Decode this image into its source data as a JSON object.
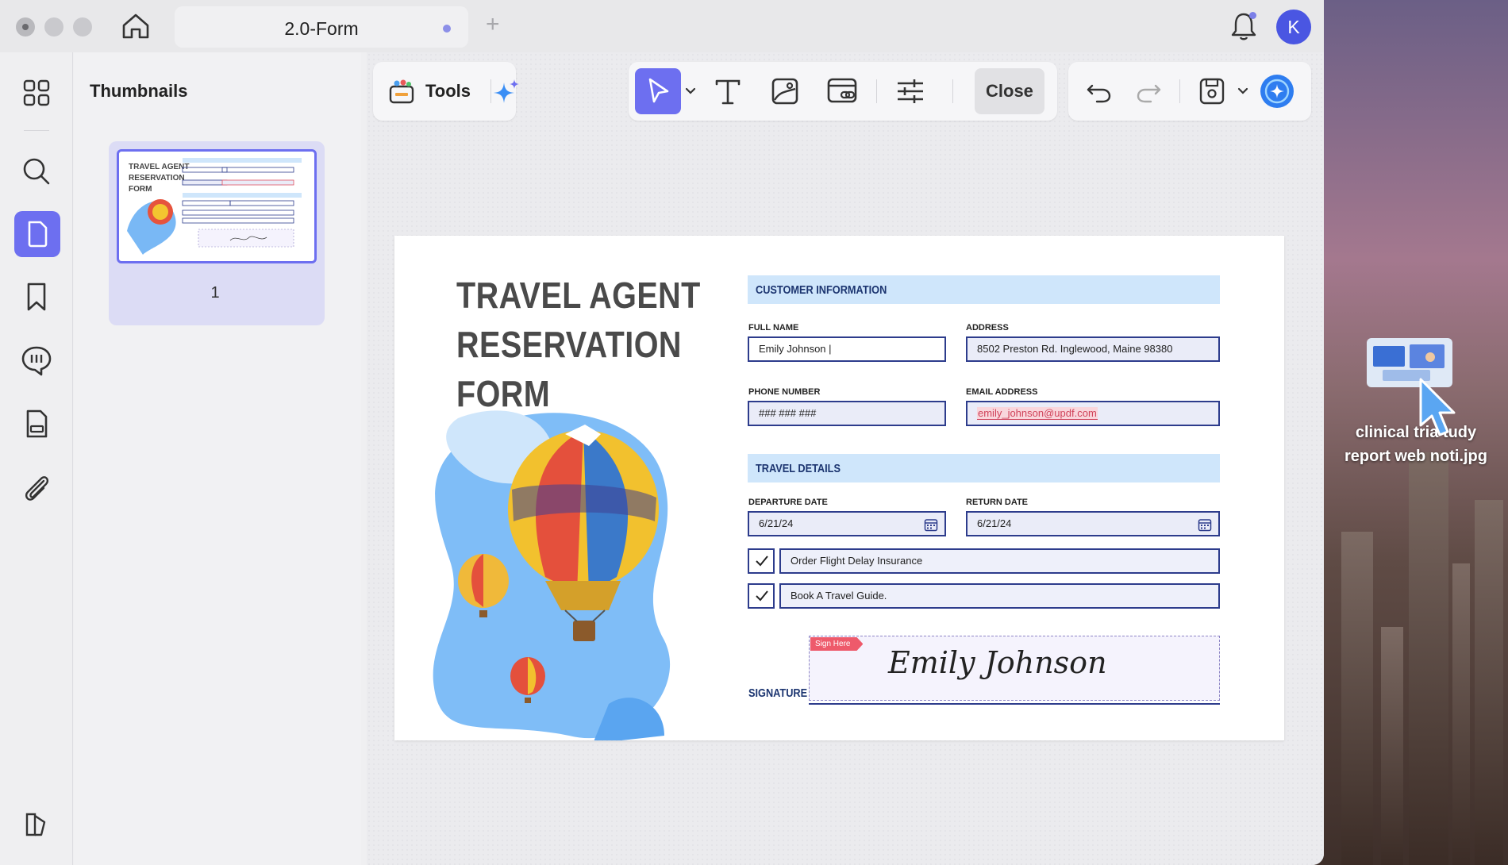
{
  "window": {
    "tab_title": "2.0-Form",
    "tab_add": "+",
    "avatar_letter": "K",
    "accent": "#6d6ff0"
  },
  "sidebar": {
    "icons": [
      "grid-icon",
      "search-icon",
      "page-icon",
      "bookmark-icon",
      "comment-icon",
      "form-icon",
      "attachment-icon",
      "layers-icon"
    ],
    "active": "page-icon"
  },
  "thumbnails": {
    "title": "Thumbnails",
    "page_number": "1"
  },
  "toolbar": {
    "tools_label": "Tools",
    "close_label": "Close"
  },
  "form": {
    "title_lines": [
      "TRAVEL AGENT",
      "RESERVATION",
      "FORM"
    ],
    "customer_info": "CUSTOMER INFORMATION",
    "full_name_label": "FULL NAME",
    "full_name_value": "Emily Johnson |",
    "address_label": "ADDRESS",
    "address_value": "8502 Preston Rd. Inglewood, Maine 98380",
    "phone_label": "PHONE NUMBER",
    "phone_value": "### ### ###",
    "email_label": "EMAIL ADDRESS",
    "email_value": "emily_johnson@updf.com",
    "travel_details": "TRAVEL DETAILS",
    "departure_label": "DEPARTURE DATE",
    "departure_value": "6/21/24",
    "return_label": "RETURN DATE",
    "return_value": "6/21/24",
    "check1": "Order Flight Delay Insurance",
    "check2": "Book A Travel Guide.",
    "signature_label": "SIGNATURE L",
    "sign_here": "Sign Here",
    "signature_value": "Emily Johnson"
  },
  "desktop": {
    "file_label_line1": "clinical tria tudy",
    "file_label_line2": "report web noti.jpg"
  }
}
